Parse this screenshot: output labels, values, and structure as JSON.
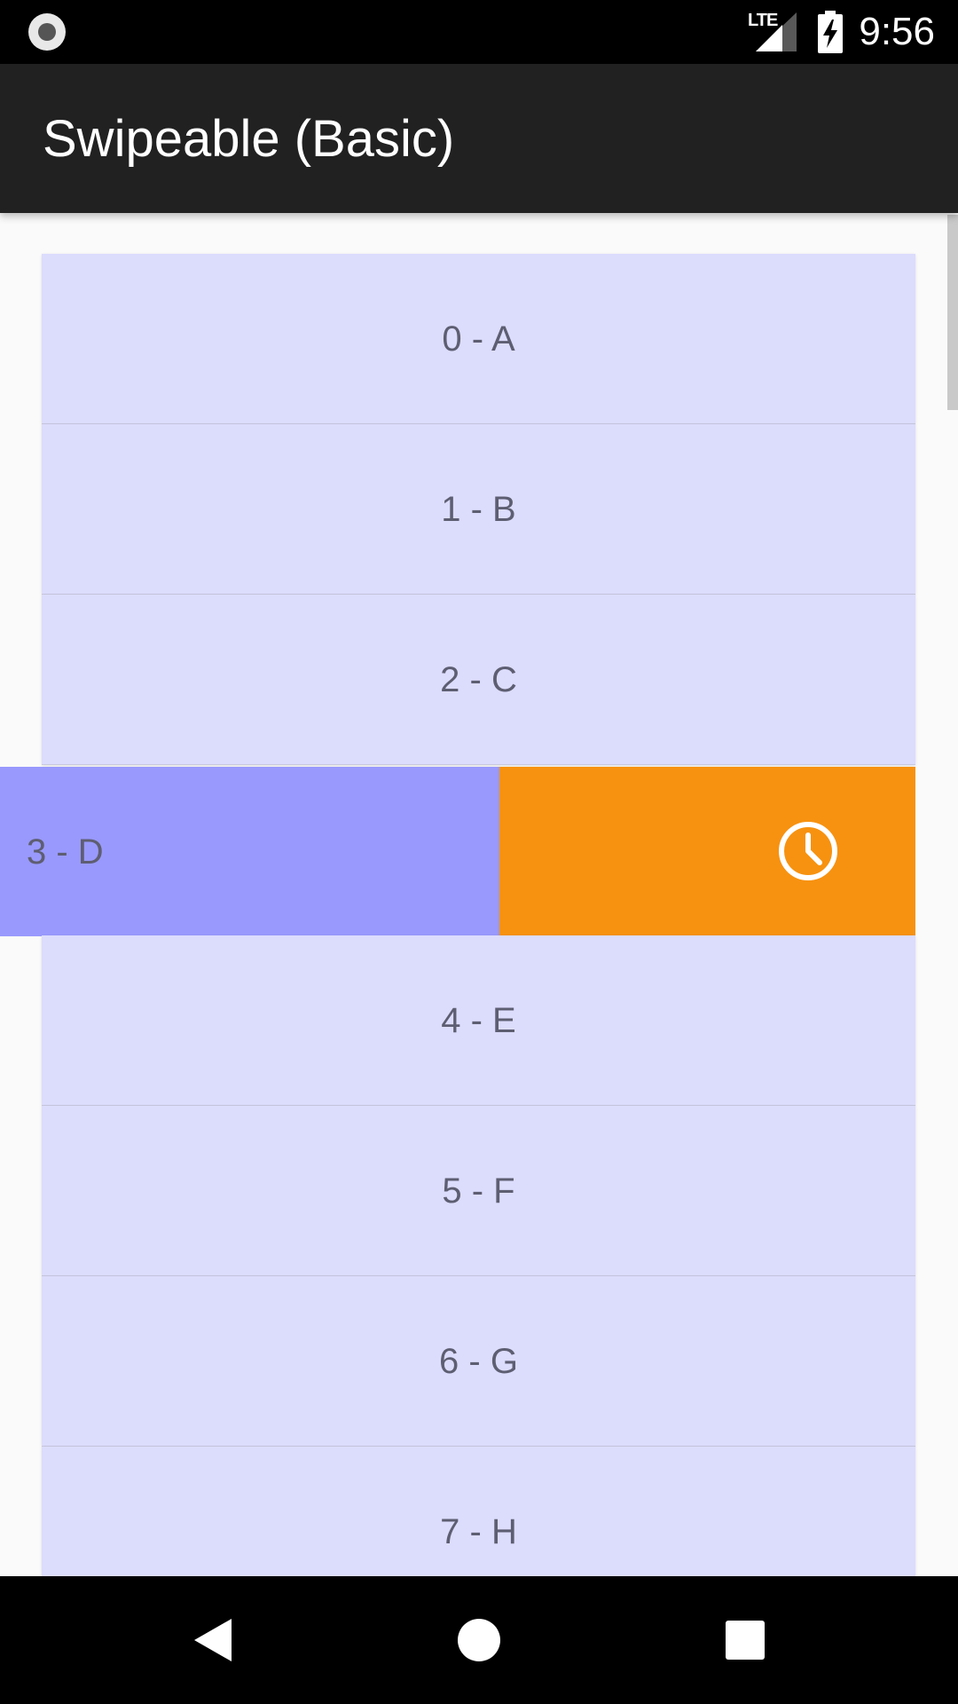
{
  "status_bar": {
    "network_label": "LTE",
    "time": "9:56",
    "icons": [
      "notification-dot-icon",
      "signal-icon",
      "battery-charging-icon"
    ]
  },
  "app_bar": {
    "title": "Swipeable (Basic)"
  },
  "list": {
    "items": [
      {
        "label": "0 - A"
      },
      {
        "label": "1 - B"
      },
      {
        "label": "2 - C"
      },
      {
        "label": "3 - D"
      },
      {
        "label": "4 - E"
      },
      {
        "label": "5 - F"
      },
      {
        "label": "6 - G"
      },
      {
        "label": "7 - H"
      }
    ],
    "swiped_item": {
      "label": "3 - D",
      "action_icon": "clock-icon",
      "action_color": "#f79210"
    }
  },
  "nav_bar": {
    "buttons": [
      "back-icon",
      "home-icon",
      "recents-icon"
    ]
  },
  "colors": {
    "row_background": "#dcdcfd",
    "swiped_row_background": "#9999fd",
    "app_bar": "#212121",
    "text": "#5e5e72"
  }
}
